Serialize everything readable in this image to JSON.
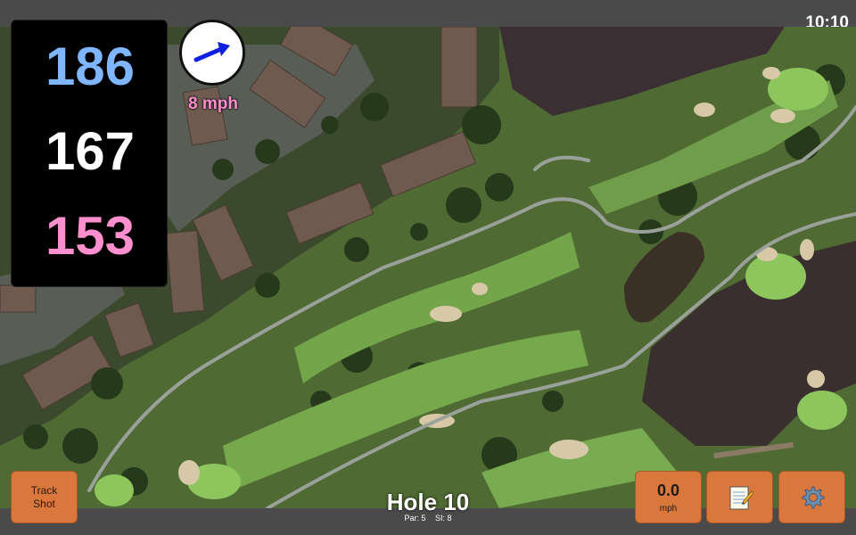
{
  "status_bar": {
    "time": "10:10"
  },
  "distances": {
    "back": "186",
    "middle": "167",
    "front": "153"
  },
  "wind": {
    "speed": "8 mph",
    "direction_icon": "arrow-right-icon"
  },
  "hole": {
    "title": "Hole 10",
    "par": "Par: 5",
    "si": "SI: 8"
  },
  "buttons": {
    "track_shot": {
      "line1": "Track",
      "line2": "Shot"
    },
    "speed": {
      "value": "0.0",
      "unit": "mph"
    },
    "notes_icon": "notepad-icon",
    "settings_icon": "gear-icon"
  },
  "colors": {
    "back_distance": "#7fb6ff",
    "middle_distance": "#ffffff",
    "front_distance": "#ff8fcf",
    "button": "#d9773c",
    "wind_text": "#ff8fcf"
  }
}
